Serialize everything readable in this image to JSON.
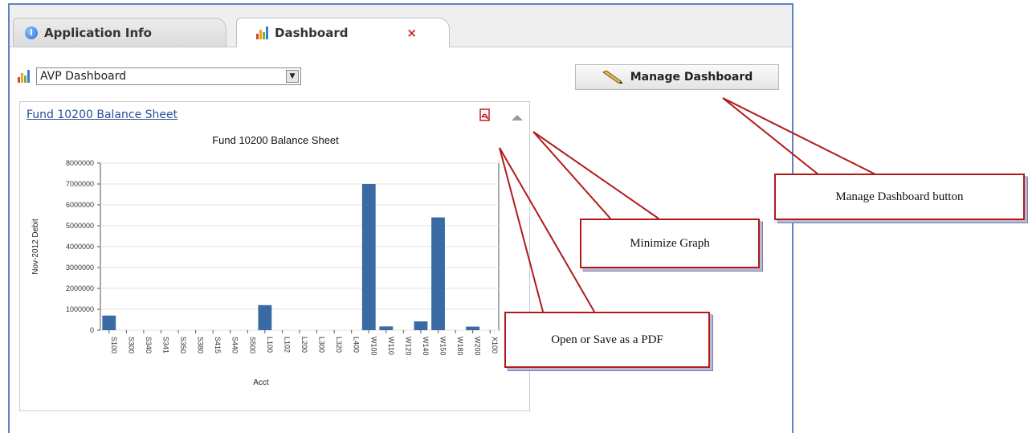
{
  "tabs": [
    {
      "label": "Application Info",
      "icon": "info-icon",
      "active": false
    },
    {
      "label": "Dashboard",
      "icon": "bar-chart-icon",
      "active": true,
      "close": "×"
    }
  ],
  "dashboard_select": {
    "value": "AVP Dashboard"
  },
  "manage_button": {
    "label": "Manage Dashboard",
    "icon": "pencil-icon"
  },
  "panel": {
    "title": "Fund 10200 Balance Sheet"
  },
  "callouts": {
    "manage": "Manage Dashboard button",
    "minimize": "Minimize Graph",
    "pdf": "Open or Save as a PDF"
  },
  "colors": {
    "bar": "#3a6aa3",
    "callout_border": "#b11a1a",
    "frame": "#5b84c4",
    "close": "#d02020"
  },
  "chart_data": {
    "type": "bar",
    "title": "Fund 10200 Balance Sheet",
    "xlabel": "Acct",
    "ylabel": "Nov-2012 Debit",
    "ylim": [
      0,
      8000000
    ],
    "yticks": [
      0,
      1000000,
      2000000,
      3000000,
      4000000,
      5000000,
      6000000,
      7000000,
      8000000
    ],
    "categories": [
      "S100",
      "S300",
      "S340",
      "S341",
      "S350",
      "S380",
      "S415",
      "S440",
      "S500",
      "L100",
      "L102",
      "L200",
      "L300",
      "L320",
      "L400",
      "W100",
      "W110",
      "W120",
      "W140",
      "W150",
      "W180",
      "W200",
      "X100"
    ],
    "values": [
      700000,
      0,
      0,
      0,
      0,
      0,
      0,
      0,
      0,
      1200000,
      0,
      0,
      0,
      0,
      0,
      7000000,
      180000,
      0,
      420000,
      5400000,
      0,
      170000,
      0
    ],
    "grid": true
  }
}
